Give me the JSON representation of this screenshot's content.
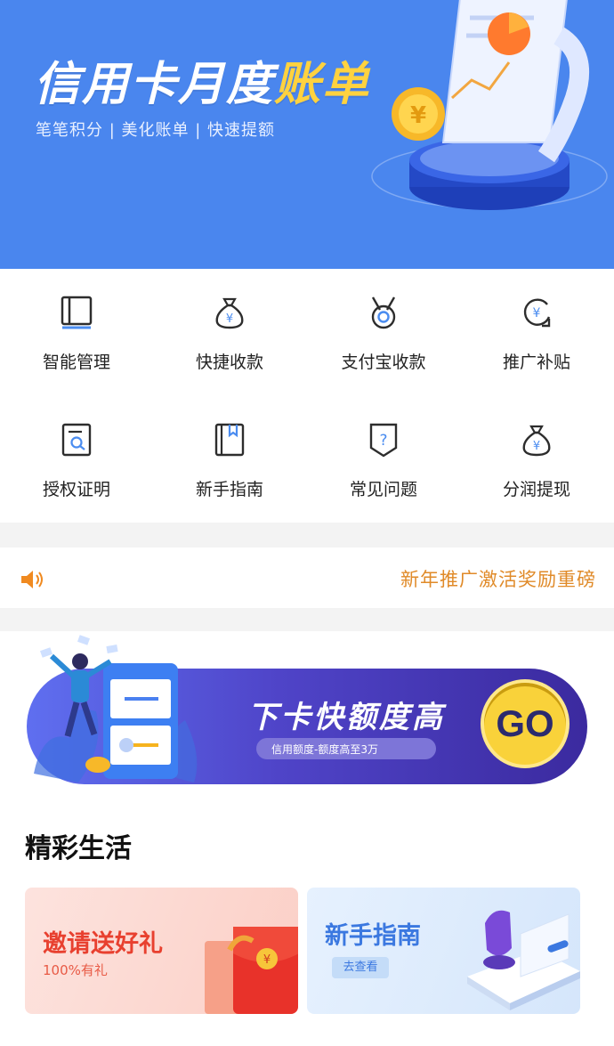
{
  "banner": {
    "title_main": "信用卡月度",
    "title_highlight": "账单",
    "subtitle": "笔笔积分 | 美化账单 | 快速提额"
  },
  "menu": {
    "items": [
      {
        "label": "智能管理",
        "icon": "book-icon"
      },
      {
        "label": "快捷收款",
        "icon": "money-bag-icon"
      },
      {
        "label": "支付宝收款",
        "icon": "medal-icon"
      },
      {
        "label": "推广补贴",
        "icon": "refresh-yen-icon"
      },
      {
        "label": "授权证明",
        "icon": "document-search-icon"
      },
      {
        "label": "新手指南",
        "icon": "bookmark-book-icon"
      },
      {
        "label": "常见问题",
        "icon": "question-shield-icon"
      },
      {
        "label": "分润提现",
        "icon": "money-bag-icon"
      }
    ]
  },
  "notice": {
    "text": "新年推广激活奖励重磅",
    "icon": "speaker-icon"
  },
  "promo": {
    "title": "下卡快额度高",
    "subtitle": "信用额度-额度高至3万",
    "button": "GO"
  },
  "section": {
    "title": "精彩生活",
    "cards": [
      {
        "title": "邀请送好礼",
        "subtitle": "100%有礼"
      },
      {
        "title": "新手指南",
        "button": "去查看"
      }
    ]
  },
  "colors": {
    "banner_bg": "#4a86ee",
    "highlight_yellow": "#ffd23f",
    "notice_orange": "#e08a28",
    "promo_purple": "#4f44c8",
    "go_yellow": "#f9d23a",
    "card_red": "#e8402f",
    "card_blue": "#3b78e0"
  }
}
